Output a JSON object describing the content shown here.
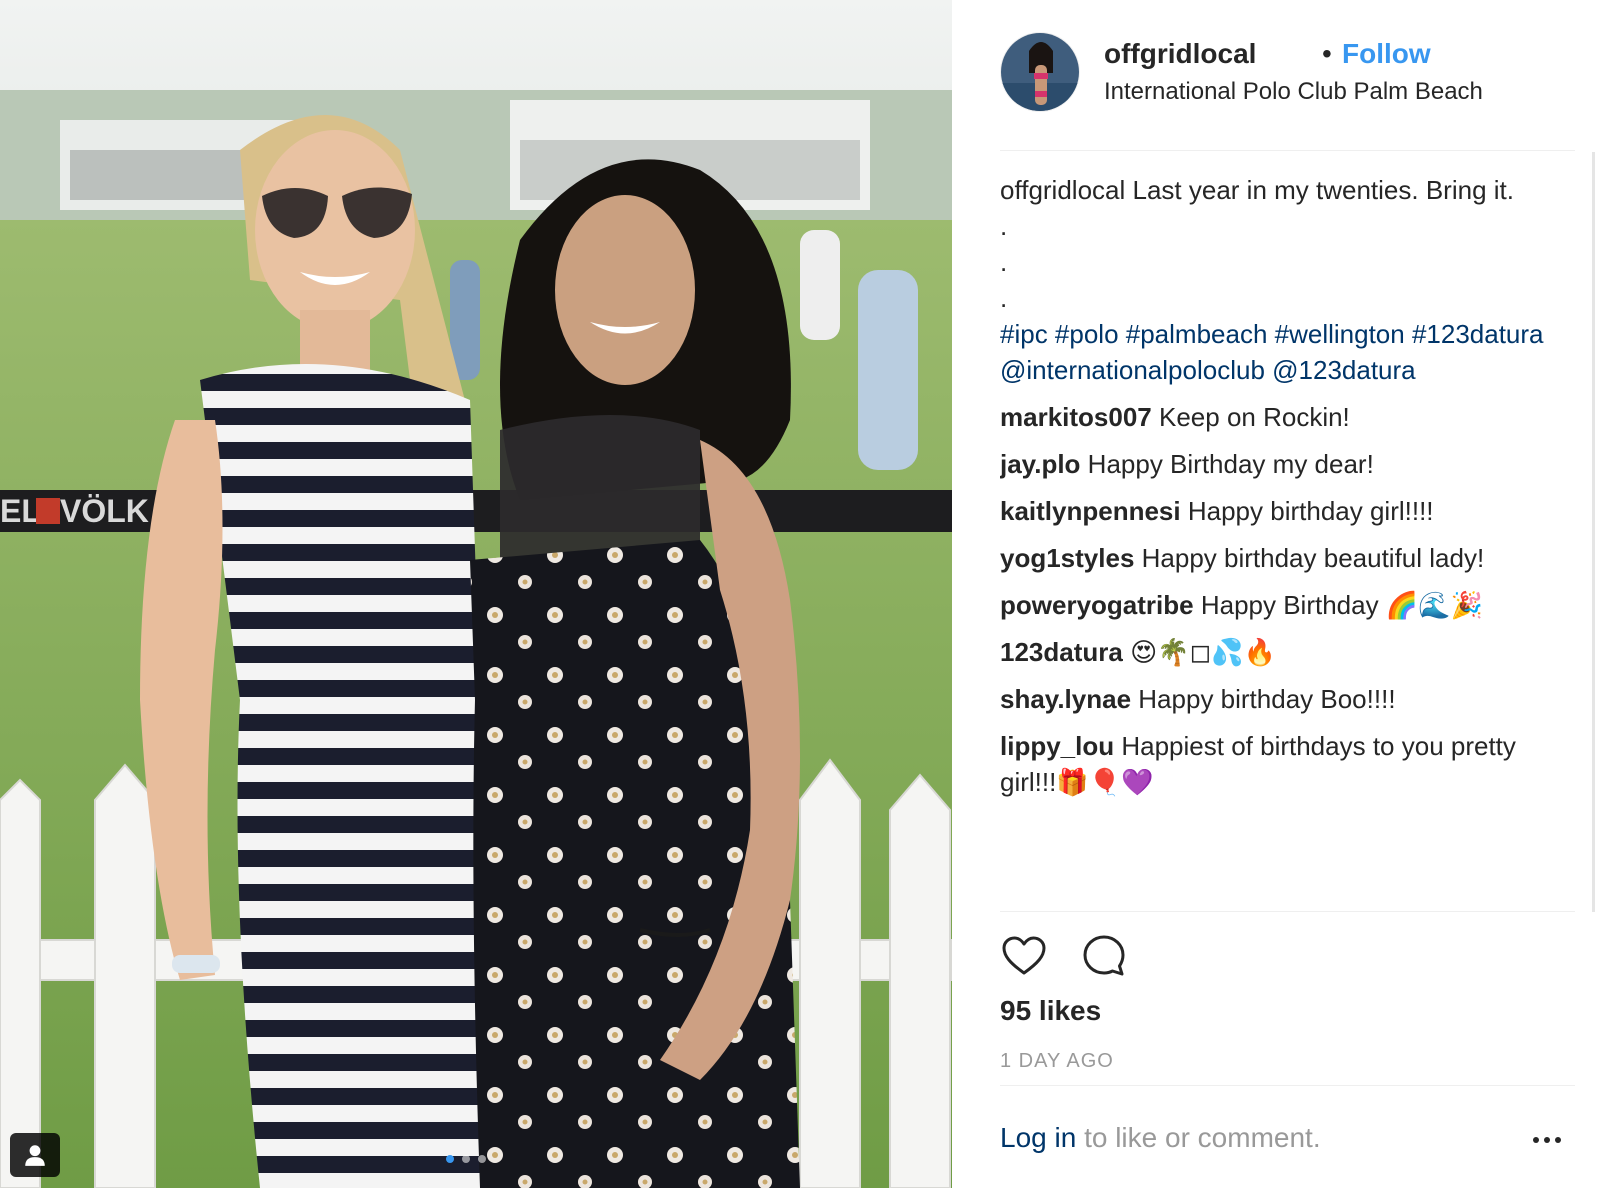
{
  "post": {
    "username": "offgridlocal",
    "follow_label": "Follow",
    "location": "International Polo Club Palm Beach"
  },
  "caption": {
    "user": "offgridlocal",
    "text": "Last year in my twenties. Bring it.",
    "dots": [
      ".",
      ".",
      "."
    ],
    "hashtags": "#ipc #polo #palmbeach #wellington #123datura @internationalpoloclub @123datura"
  },
  "comments": [
    {
      "user": "markitos007",
      "text": "Keep on Rockin!"
    },
    {
      "user": "jay.plo",
      "text": "Happy Birthday my dear!"
    },
    {
      "user": "kaitlynpennesi",
      "text": "Happy birthday girl!!!!"
    },
    {
      "user": "yog1styles",
      "text": "Happy birthday beautiful lady!"
    },
    {
      "user": "poweryogatribe",
      "text": "Happy Birthday 🌈🌊🎉"
    },
    {
      "user": "123datura",
      "text": "😍🌴◻💦🔥"
    },
    {
      "user": "shay.lynae",
      "text": "Happy birthday Boo!!!!"
    },
    {
      "user": "lippy_lou",
      "text": "Happiest of birthdays to you pretty girl!!!🎁🎈💜"
    }
  ],
  "stats": {
    "likes": "95 likes",
    "time": "1 DAY AGO"
  },
  "footer": {
    "login_link": "Log in",
    "login_rest": " to like or comment."
  },
  "icons": {
    "like": "heart-icon",
    "comment": "comment-icon",
    "more": "more-options-icon",
    "tag": "user-tag-icon"
  },
  "carousel": {
    "count": 3,
    "active": 0
  },
  "colors": {
    "link": "#3897f0",
    "hashtag": "#003569",
    "text": "#262626",
    "muted": "#999999"
  }
}
